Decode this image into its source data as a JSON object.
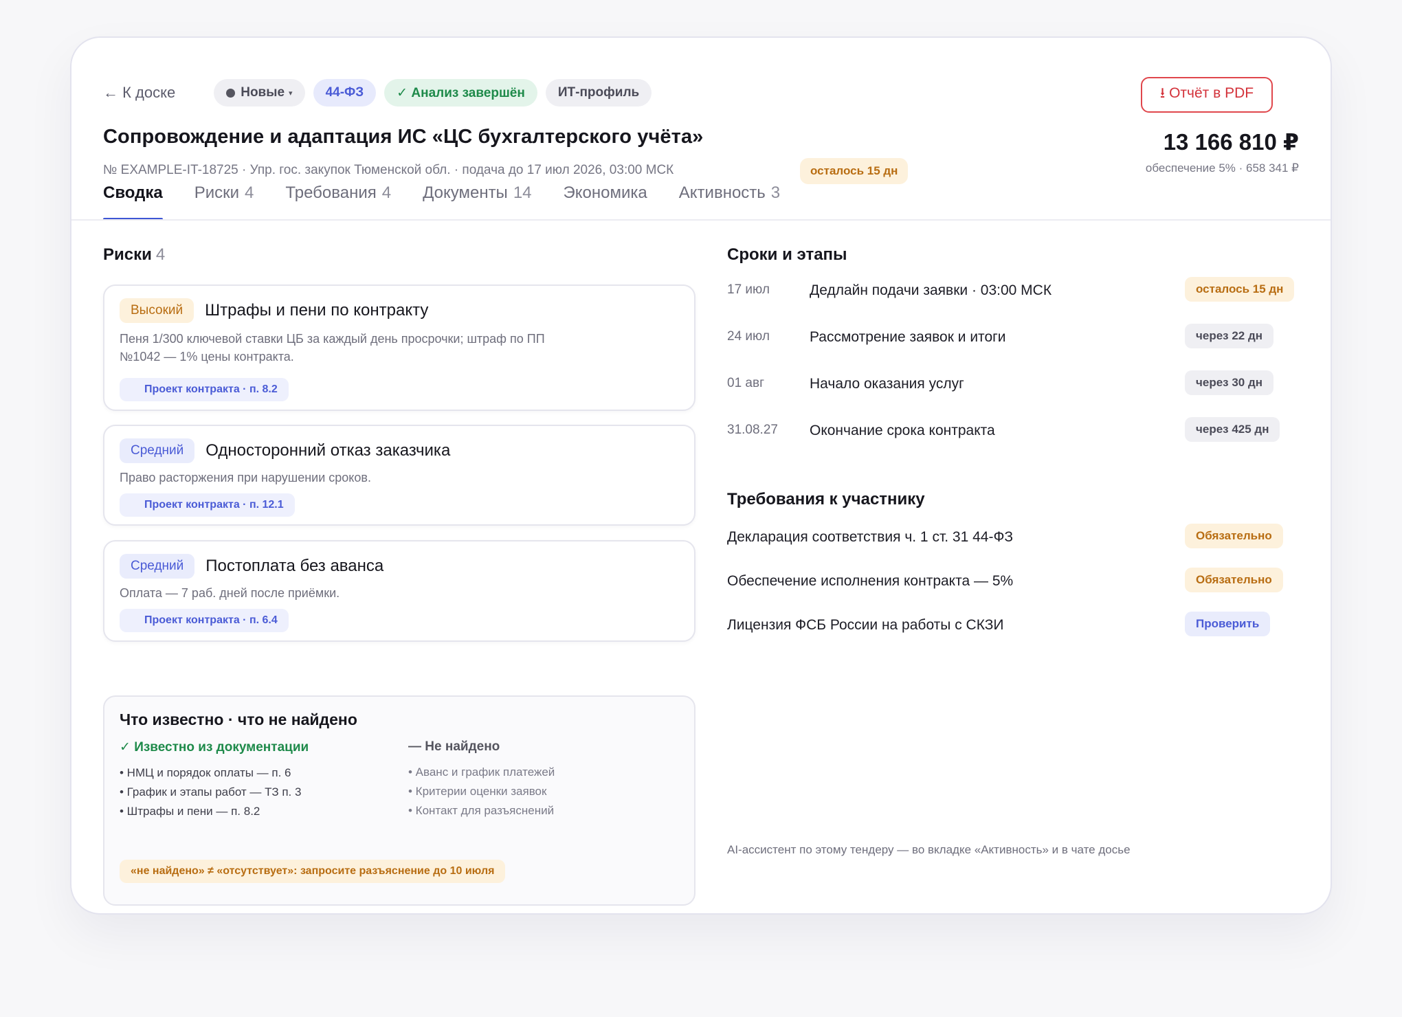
{
  "header": {
    "back_label": "← К доске",
    "status": "Новые",
    "law": "44-ФЗ",
    "analysis": "✓ Анализ завершён",
    "profile": "ИТ-профиль",
    "pdf_button": "⭳ Отчёт в PDF",
    "title": "Сопровождение и адаптация ИС «ЦС бухгалтерского учёта»",
    "meta": "№ EXAMPLE-IT-18725 · Упр. гос. закупок Тюменской обл. · подача до 17 июл 2026, 03:00 МСК",
    "deadline_chip": "осталось 15 дн",
    "amount": "13 166 810 ₽",
    "security": "обеспечение 5% · 658 341 ₽"
  },
  "tabs": [
    {
      "label": "Сводка",
      "count": ""
    },
    {
      "label": "Риски",
      "count": "4"
    },
    {
      "label": "Требования",
      "count": "4"
    },
    {
      "label": "Документы",
      "count": "14"
    },
    {
      "label": "Экономика",
      "count": ""
    },
    {
      "label": "Активность",
      "count": "3"
    }
  ],
  "risks": {
    "title": "Риски",
    "count": "4",
    "items": [
      {
        "severity": "Высокий",
        "title": "Штрафы и пени по контракту",
        "desc": "Пеня 1/300 ключевой ставки ЦБ за каждый день просрочки; штраф по ПП №1042 — 1% цены контракта.",
        "ref": "Проект контракта · п. 8.2"
      },
      {
        "severity": "Средний",
        "title": "Односторонний отказ заказчика",
        "desc": "Право расторжения при нарушении сроков.",
        "ref": "Проект контракта · п. 12.1"
      },
      {
        "severity": "Средний",
        "title": "Постоплата без аванса",
        "desc": "Оплата — 7 раб. дней после приёмки.",
        "ref": "Проект контракта · п. 6.4"
      }
    ]
  },
  "known": {
    "title": "Что известно · что не найдено",
    "known_head": "✓ Известно из документации",
    "known_items": [
      "• НМЦ и порядок оплаты — п. 6",
      "• График и этапы работ — ТЗ п. 3",
      "• Штрафы и пени — п. 8.2"
    ],
    "missing_head": "— Не найдено",
    "missing_items": [
      "• Аванс и график платежей",
      "• Критерии оценки заявок",
      "• Контакт для разъяснений"
    ],
    "note": "«не найдено» ≠ «отсутствует»: запросите разъяснение до 10 июля"
  },
  "stages": {
    "title": "Сроки и этапы",
    "items": [
      {
        "date": "17 июл",
        "label": "Дедлайн подачи заявки · 03:00 МСК",
        "badge": "осталось 15 дн"
      },
      {
        "date": "24 июл",
        "label": "Рассмотрение заявок и итоги",
        "badge": "через 22 дн"
      },
      {
        "date": "01 авг",
        "label": "Начало оказания услуг",
        "badge": "через 30 дн"
      },
      {
        "date": "31.08.27",
        "label": "Окончание срока контракта",
        "badge": "через 425 дн"
      }
    ]
  },
  "requirements": {
    "title": "Требования к участнику",
    "items": [
      {
        "label": "Декларация соответствия ч. 1 ст. 31 44-ФЗ",
        "badge": "Обязательно"
      },
      {
        "label": "Обеспечение исполнения контракта — 5%",
        "badge": "Обязательно"
      },
      {
        "label": "Лицензия ФСБ России на работы с СКЗИ",
        "badge": "Проверить"
      }
    ]
  },
  "ai_note": "AI-ассистент по этому тендеру — во вкладке «Активность» и в чате досье",
  "colors": {
    "accent": "#3d55d4",
    "warning": "#b86d12",
    "success": "#1e8a4a",
    "danger": "#d3323a"
  }
}
